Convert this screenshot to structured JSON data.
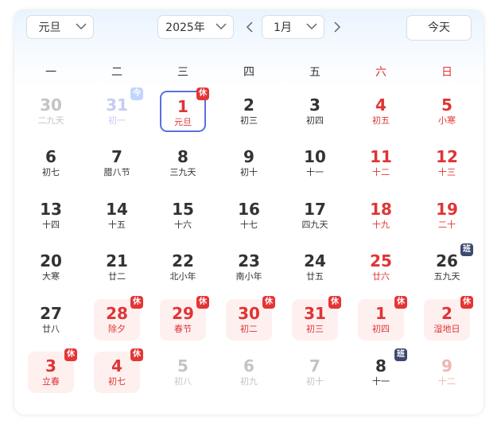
{
  "toolbar": {
    "holiday_select": "元旦",
    "year_select": "2025年",
    "month_select": "1月",
    "today_button": "今天"
  },
  "weekdays": [
    "一",
    "二",
    "三",
    "四",
    "五",
    "六",
    "日"
  ],
  "colors": {
    "red": "#e03434",
    "rest_badge": "#e43535",
    "work_badge": "#3d4a6e",
    "selected_border": "#5a6fe0",
    "holiday_bg": "#fff0f0"
  },
  "days": [
    {
      "day": "30",
      "lunar": "二九天",
      "state": "other"
    },
    {
      "day": "31",
      "lunar": "初一",
      "state": "today",
      "badge": "今"
    },
    {
      "day": "1",
      "lunar": "元旦",
      "state": "selected",
      "badge": "休"
    },
    {
      "day": "2",
      "lunar": "初三"
    },
    {
      "day": "3",
      "lunar": "初四"
    },
    {
      "day": "4",
      "lunar": "初五"
    },
    {
      "day": "5",
      "lunar": "小寒"
    },
    {
      "day": "6",
      "lunar": "初七"
    },
    {
      "day": "7",
      "lunar": "腊八节"
    },
    {
      "day": "8",
      "lunar": "三九天"
    },
    {
      "day": "9",
      "lunar": "初十"
    },
    {
      "day": "10",
      "lunar": "十一"
    },
    {
      "day": "11",
      "lunar": "十二"
    },
    {
      "day": "12",
      "lunar": "十三"
    },
    {
      "day": "13",
      "lunar": "十四"
    },
    {
      "day": "14",
      "lunar": "十五"
    },
    {
      "day": "15",
      "lunar": "十六"
    },
    {
      "day": "16",
      "lunar": "十七"
    },
    {
      "day": "17",
      "lunar": "四九天"
    },
    {
      "day": "18",
      "lunar": "十九"
    },
    {
      "day": "19",
      "lunar": "二十"
    },
    {
      "day": "20",
      "lunar": "大寒"
    },
    {
      "day": "21",
      "lunar": "廿二"
    },
    {
      "day": "22",
      "lunar": "北小年"
    },
    {
      "day": "23",
      "lunar": "南小年"
    },
    {
      "day": "24",
      "lunar": "廿五"
    },
    {
      "day": "25",
      "lunar": "廿六"
    },
    {
      "day": "26",
      "lunar": "五九天",
      "badge": "班",
      "badgeType": "work",
      "nored": true
    },
    {
      "day": "27",
      "lunar": "廿八"
    },
    {
      "day": "28",
      "lunar": "除夕",
      "state": "holiday",
      "badge": "休"
    },
    {
      "day": "29",
      "lunar": "春节",
      "state": "holiday",
      "badge": "休"
    },
    {
      "day": "30",
      "lunar": "初二",
      "state": "holiday",
      "badge": "休"
    },
    {
      "day": "31",
      "lunar": "初三",
      "state": "holiday",
      "badge": "休"
    },
    {
      "day": "1",
      "lunar": "初四",
      "state": "holiday",
      "badge": "休"
    },
    {
      "day": "2",
      "lunar": "湿地日",
      "state": "holiday",
      "badge": "休"
    },
    {
      "day": "3",
      "lunar": "立春",
      "state": "holiday",
      "badge": "休"
    },
    {
      "day": "4",
      "lunar": "初七",
      "state": "holiday",
      "badge": "休"
    },
    {
      "day": "5",
      "lunar": "初八",
      "state": "other"
    },
    {
      "day": "6",
      "lunar": "初九",
      "state": "other"
    },
    {
      "day": "7",
      "lunar": "初十",
      "state": "other"
    },
    {
      "day": "8",
      "lunar": "十一",
      "badge": "班",
      "badgeType": "work",
      "nored": true
    },
    {
      "day": "9",
      "lunar": "十二",
      "state": "other"
    }
  ]
}
